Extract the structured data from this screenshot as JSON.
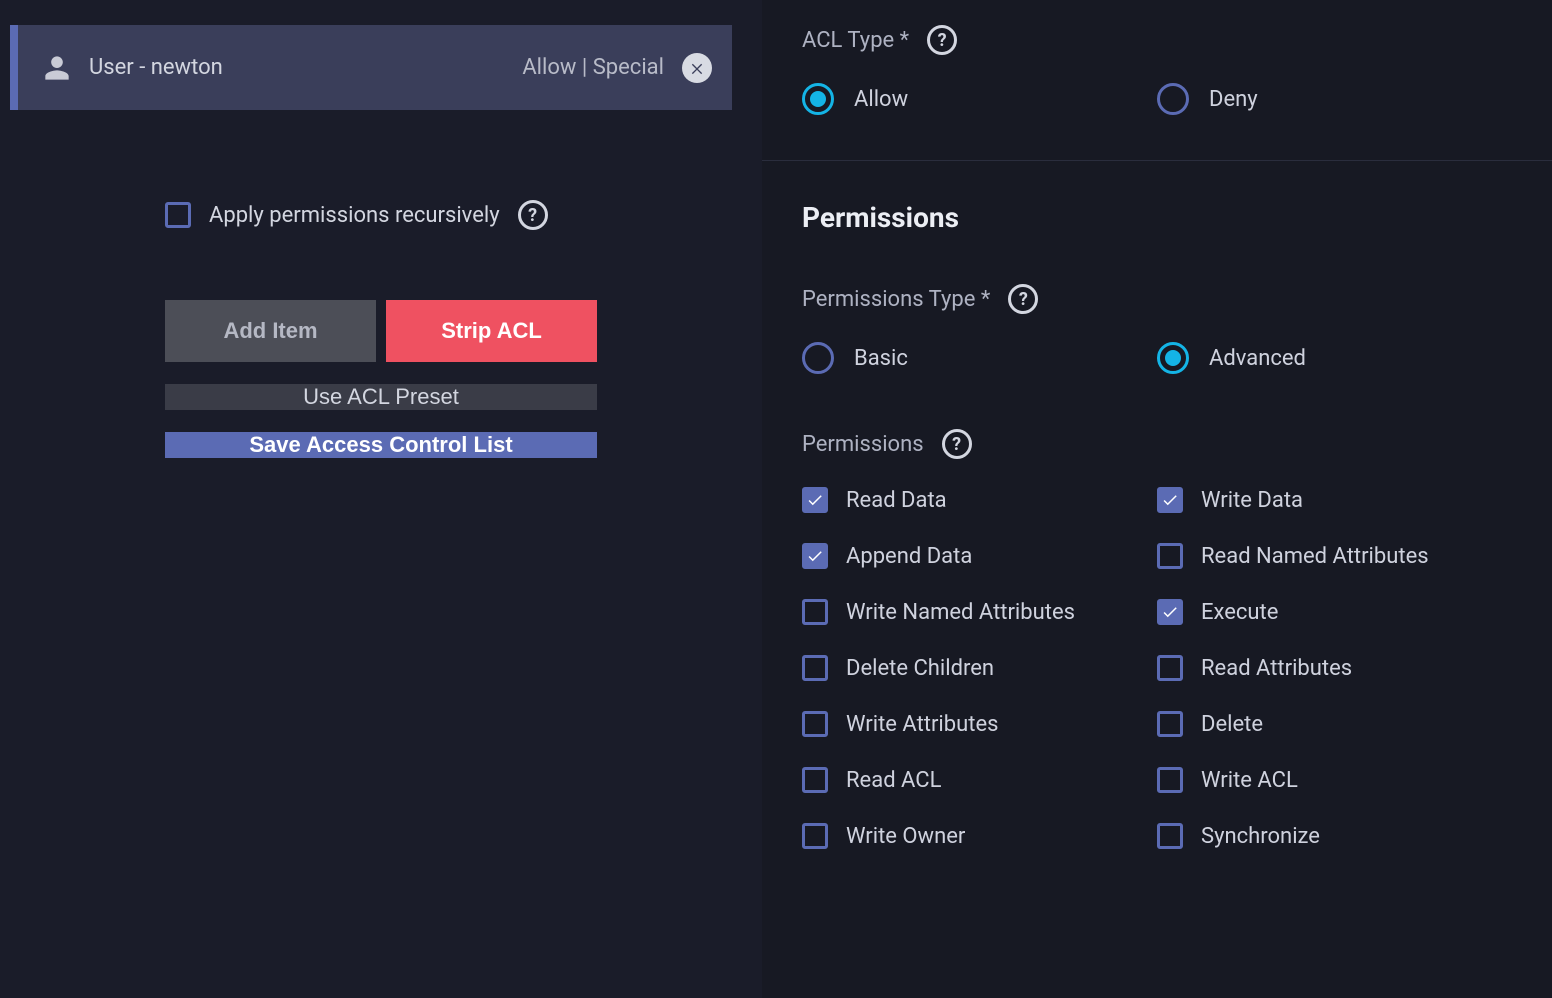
{
  "acl_entry": {
    "title": "User - newton",
    "meta": "Allow | Special"
  },
  "left": {
    "recursive_label": "Apply permissions recursively",
    "recursive_checked": false,
    "add_item": "Add Item",
    "strip_acl": "Strip ACL",
    "use_preset": "Use ACL Preset",
    "save": "Save Access Control List"
  },
  "acl_type": {
    "label": "ACL Type *",
    "options": [
      {
        "label": "Allow",
        "selected": true
      },
      {
        "label": "Deny",
        "selected": false
      }
    ]
  },
  "permissions_heading": "Permissions",
  "permissions_type": {
    "label": "Permissions Type *",
    "options": [
      {
        "label": "Basic",
        "selected": false
      },
      {
        "label": "Advanced",
        "selected": true
      }
    ]
  },
  "permissions_section": {
    "label": "Permissions",
    "items": [
      {
        "label": "Read Data",
        "checked": true
      },
      {
        "label": "Write Data",
        "checked": true
      },
      {
        "label": "Append Data",
        "checked": true
      },
      {
        "label": "Read Named Attributes",
        "checked": false
      },
      {
        "label": "Write Named Attributes",
        "checked": false
      },
      {
        "label": "Execute",
        "checked": true
      },
      {
        "label": "Delete Children",
        "checked": false
      },
      {
        "label": "Read Attributes",
        "checked": false
      },
      {
        "label": "Write Attributes",
        "checked": false
      },
      {
        "label": "Delete",
        "checked": false
      },
      {
        "label": "Read ACL",
        "checked": false
      },
      {
        "label": "Write ACL",
        "checked": false
      },
      {
        "label": "Write Owner",
        "checked": false
      },
      {
        "label": "Synchronize",
        "checked": false
      }
    ]
  }
}
